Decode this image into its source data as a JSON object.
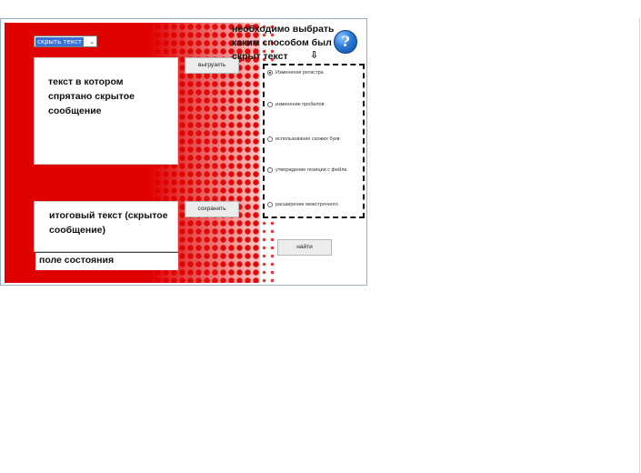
{
  "window": {
    "select_value": "скрыть текст",
    "select_arrow": "⌄",
    "input_label": "текст в котором спрятано скрытое сообщение",
    "result_label": "итоговый текст (скрытое сообщение)",
    "status_label": "поле состояния",
    "note": "необходимо выбрать каким способом был скрыт текст",
    "help_glyph": "?",
    "arrow_glyph": "⇩",
    "buttons": {
      "load": "выгрузить",
      "save": "сохранить",
      "find": "найти"
    },
    "radio_options": [
      {
        "label": "Изменение регистра",
        "selected": true
      },
      {
        "label": "изменение пробелов",
        "selected": false
      },
      {
        "label": "использование схожих букв",
        "selected": false
      },
      {
        "label": "утверждение позиции с фейла",
        "selected": false
      },
      {
        "label": "расширение межстрочного",
        "selected": false
      }
    ],
    "colors": {
      "accent_red": "#e00000",
      "help_blue": "#2b7ad8",
      "selection_blue": "#3874d8"
    }
  }
}
